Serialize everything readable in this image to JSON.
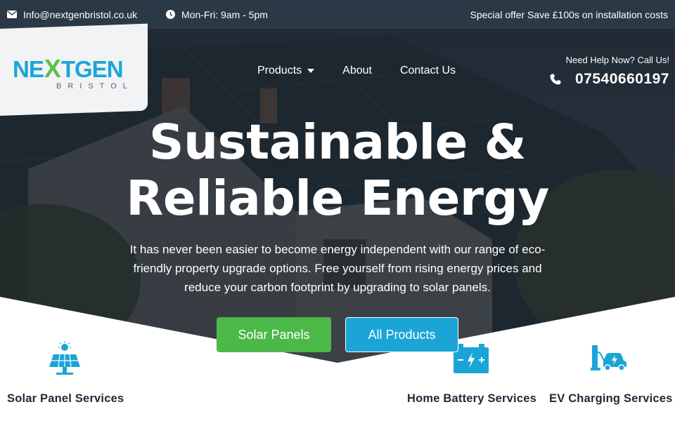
{
  "topbar": {
    "email": "Info@nextgenbristol.co.uk",
    "hours": "Mon-Fri: 9am - 5pm",
    "offer": "Special offer Save £100s on installation costs"
  },
  "brand": {
    "name_left": "NE",
    "name_x": "X",
    "name_right": "TGEN",
    "sub": "BRISTOL",
    "colors": {
      "blue": "#1aa6d8",
      "green": "#5fbf47"
    }
  },
  "nav": {
    "items": [
      {
        "label": "Products",
        "has_dropdown": true
      },
      {
        "label": "About"
      },
      {
        "label": "Contact Us"
      }
    ]
  },
  "call": {
    "help": "Need Help Now? Call Us!",
    "phone": "07540660197"
  },
  "hero": {
    "headline_line1": "Sustainable &",
    "headline_line2": "Reliable Energy",
    "lede": "It has never been easier to become energy independent with our range of eco-friendly property upgrade options. Free yourself from rising energy prices and reduce your carbon footprint by upgrading to solar panels.",
    "cta_primary": "Solar Panels",
    "cta_secondary": "All Products",
    "colors": {
      "primary": "#4cb848",
      "secondary": "#1ba5d6"
    }
  },
  "services": [
    {
      "title": "Solar Panel Services",
      "icon": "solar-panel-icon"
    },
    {
      "title": "Home Battery Services",
      "icon": "battery-icon"
    },
    {
      "title": "EV Charging Services",
      "icon": "ev-charger-icon"
    }
  ],
  "icons": {
    "email": "envelope-icon",
    "hours": "clock-icon",
    "phone": "phone-icon",
    "caret": "chevron-down-icon"
  }
}
